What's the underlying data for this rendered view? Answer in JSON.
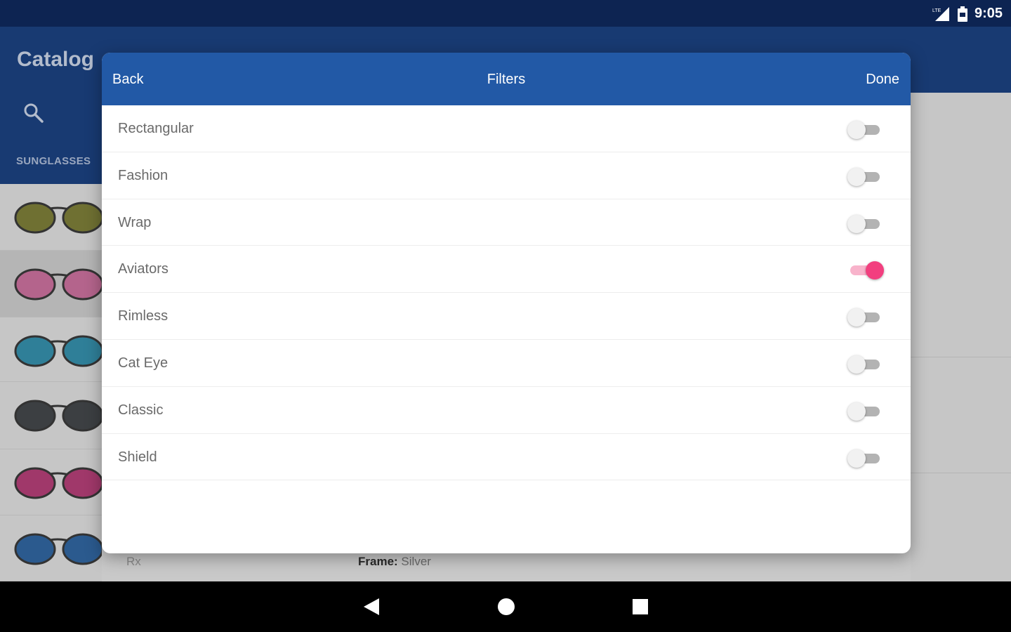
{
  "status_bar": {
    "time": "9:05",
    "network_label": "LTE"
  },
  "app": {
    "title": "Catalog",
    "category": "SUNGLASSES",
    "lens_colors": [
      "#6f7032",
      "#b4648c",
      "#2f7f98",
      "#3c3f42",
      "#a0386a",
      "#2b5a8e"
    ]
  },
  "background_text": {
    "rx_label": "Rx",
    "frame_label": "Frame:",
    "frame_value": "Silver"
  },
  "dialog": {
    "back_label": "Back",
    "title": "Filters",
    "done_label": "Done",
    "filters": [
      {
        "label": "Rectangular",
        "on": false
      },
      {
        "label": "Fashion",
        "on": false
      },
      {
        "label": "Wrap",
        "on": false
      },
      {
        "label": "Aviators",
        "on": true
      },
      {
        "label": "Rimless",
        "on": false
      },
      {
        "label": "Cat Eye",
        "on": false
      },
      {
        "label": "Classic",
        "on": false
      },
      {
        "label": "Shield",
        "on": false
      }
    ]
  },
  "colors": {
    "header_blue": "#2259a6",
    "toggle_on": "#f23f7f",
    "status_bar": "#0d2452"
  },
  "nav": {
    "back": "back-icon",
    "home": "home-icon",
    "recents": "recents-icon"
  }
}
